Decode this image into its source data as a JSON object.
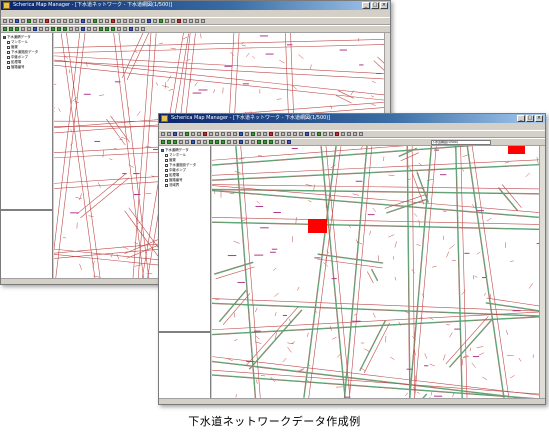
{
  "back_window": {
    "title": "Scherica Map Manager - [下水道ネットワーク - 下水道網図(1/500)]",
    "menu": [
      "File",
      "Edit",
      "View",
      "Tool",
      "Window",
      "Help"
    ],
    "layer_panel": {
      "root": "下水道網データ",
      "items": [
        "マンホール",
        "管渠",
        "下水道施設データ",
        "中継ポンプ",
        "処理場",
        "管路番号"
      ]
    },
    "status": ""
  },
  "front_window": {
    "title": "Scherica Map Manager - [下水道ネットワーク - 下水道網図(1/500)]",
    "menu": [
      "File",
      "Edit",
      "View",
      "Tool",
      "Window",
      "Help"
    ],
    "combo_label": "下水道網図(1/500)",
    "layer_panel": {
      "root": "下水道網データ",
      "items": [
        "マンホール",
        "管渠",
        "下水道施設データ",
        "中継ポンプ",
        "処理場",
        "管路番号",
        "流域界"
      ]
    },
    "status": ""
  },
  "colors": {
    "road_line": "#c04a4a",
    "network_line": "#5fa87a",
    "highlight": "#ff0000",
    "label_text": "#b03a8a"
  },
  "caption": "下水道ネットワークデータ作成例"
}
